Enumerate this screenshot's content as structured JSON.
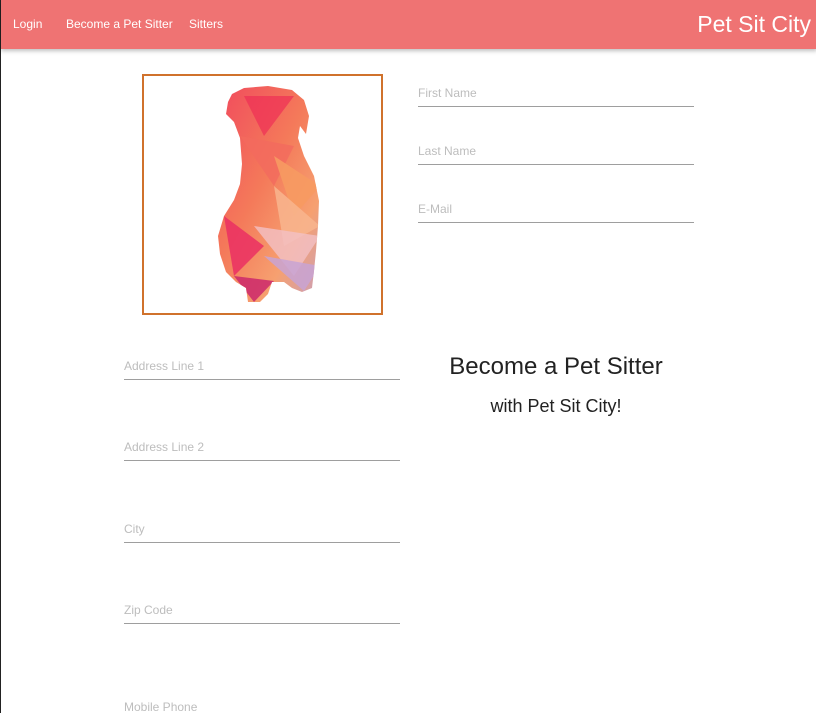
{
  "nav": {
    "links": [
      {
        "label": "Login"
      },
      {
        "label": "Become a Pet Sitter"
      },
      {
        "label": "Sitters"
      }
    ],
    "brand": "Pet Sit City"
  },
  "form": {
    "first_name": {
      "placeholder": "First Name",
      "value": ""
    },
    "last_name": {
      "placeholder": "Last Name",
      "value": ""
    },
    "email": {
      "placeholder": "E-Mail",
      "value": ""
    },
    "address1": {
      "placeholder": "Address Line 1",
      "value": ""
    },
    "address2": {
      "placeholder": "Address Line 2",
      "value": ""
    },
    "city": {
      "placeholder": "City",
      "value": ""
    },
    "zip": {
      "placeholder": "Zip Code",
      "value": ""
    },
    "mobile": {
      "placeholder": "Mobile Phone",
      "value": ""
    }
  },
  "promo": {
    "title": "Become a Pet Sitter",
    "subtitle": "with Pet Sit City!"
  },
  "colors": {
    "navbar": "#ef7373",
    "frame_border": "#d0722c"
  }
}
